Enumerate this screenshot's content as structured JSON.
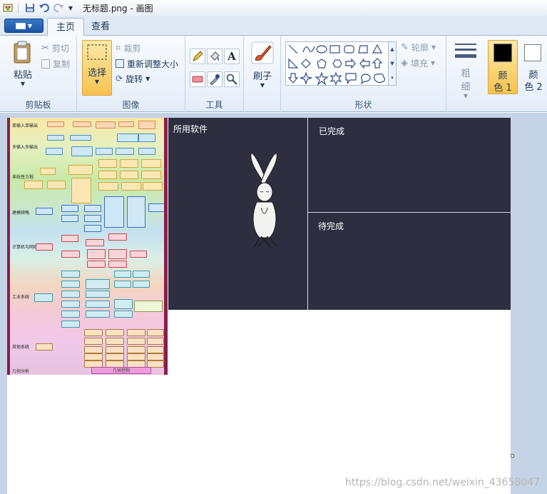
{
  "window": {
    "title": "无标题.png - 画图"
  },
  "tabs": {
    "home": "主页",
    "view": "查看"
  },
  "clipboard": {
    "paste": "粘贴",
    "cut": "剪切",
    "copy": "复制",
    "group": "剪贴板"
  },
  "image": {
    "select": "选择",
    "crop": "裁剪",
    "resize": "重新调整大小",
    "rotate": "旋转",
    "group": "图像"
  },
  "tools": {
    "group": "工具"
  },
  "brush": {
    "label": "刷子"
  },
  "shapes": {
    "outline": "轮廓",
    "fill": "填充",
    "group": "形状"
  },
  "size": {
    "label1": "粗",
    "label2": "细"
  },
  "colors": {
    "color1_a": "颜",
    "color1_b": "色 1",
    "color2_a": "颜",
    "color2_b": "色 2",
    "color1_value": "#000000",
    "color2_value": "#ffffff"
  },
  "canvas_content": {
    "panel": {
      "software": "所用软件",
      "done": "已完成",
      "todo": "待完成"
    },
    "mindmap": {
      "sections": [
        "单输入单输出",
        "多输入多输出",
        "非线性方程",
        "建模辨略",
        "计算机与网络",
        "工业系统",
        "其他系统",
        "几何分析"
      ],
      "footer": "几何控制"
    }
  },
  "watermark": "https://blog.csdn.net/weixin_43658047"
}
